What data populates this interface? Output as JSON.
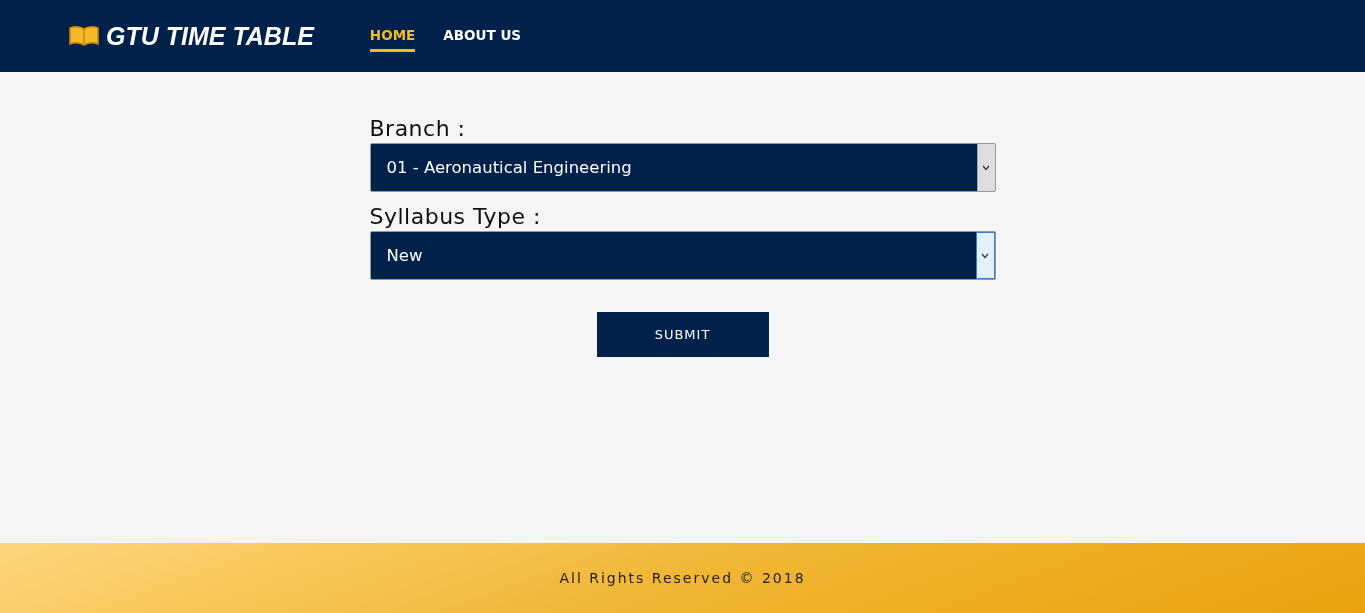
{
  "header": {
    "logo": "GTU TIME TABLE",
    "nav": [
      {
        "label": "HOME",
        "selected": true
      },
      {
        "label": "ABOUT US",
        "selected": false
      }
    ]
  },
  "form": {
    "fields": [
      {
        "label": "Branch :",
        "value": "01 - Aeronautical Engineering",
        "focused": false
      },
      {
        "label": "Syllabus Type :",
        "value": "New",
        "focused": true
      }
    ],
    "submit": "SUBMIT"
  },
  "footer": {
    "text": "All Rights Reserved © 2018"
  }
}
